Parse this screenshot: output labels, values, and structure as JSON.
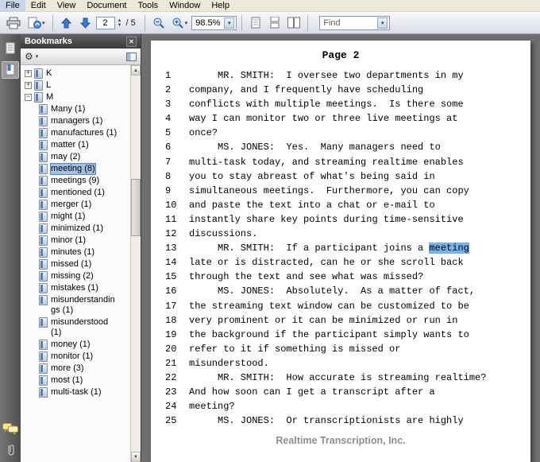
{
  "menu": {
    "items": [
      "File",
      "Edit",
      "View",
      "Document",
      "Tools",
      "Window",
      "Help"
    ]
  },
  "toolbar": {
    "page_value": "2",
    "page_total": "/ 5",
    "zoom_value": "98.5%",
    "find_value": "Find"
  },
  "icons": {
    "gear": "⚙",
    "close": "✕",
    "caret_down": "▾",
    "scroll_up": "▲",
    "scroll_down": "▼",
    "plus": "+",
    "minus": "−",
    "spinner_up": "▲",
    "spinner_down": "▼"
  },
  "colors": {
    "selection_blue": "#9cc2e8",
    "text_highlight": "#74b3ea",
    "doc_background": "#6e6e6e"
  },
  "panel": {
    "title": "Bookmarks",
    "items": [
      {
        "label": "K",
        "level": 0,
        "expander": "plus"
      },
      {
        "label": "L",
        "level": 0,
        "expander": "plus"
      },
      {
        "label": "M",
        "level": 0,
        "expander": "minus"
      },
      {
        "label": "Many (1)",
        "level": 1
      },
      {
        "label": "managers (1)",
        "level": 1
      },
      {
        "label": "manufactures (1)",
        "level": 1
      },
      {
        "label": "matter (1)",
        "level": 1
      },
      {
        "label": "may (2)",
        "level": 1
      },
      {
        "label": "meeting (8)",
        "level": 1,
        "selected": true
      },
      {
        "label": "meetings (9)",
        "level": 1
      },
      {
        "label": "mentioned (1)",
        "level": 1
      },
      {
        "label": "merger (1)",
        "level": 1
      },
      {
        "label": "might (1)",
        "level": 1
      },
      {
        "label": "minimized (1)",
        "level": 1
      },
      {
        "label": "minor (1)",
        "level": 1
      },
      {
        "label": "minutes (1)",
        "level": 1
      },
      {
        "label": "missed (1)",
        "level": 1
      },
      {
        "label": "missing (2)",
        "level": 1
      },
      {
        "label": "mistakes (1)",
        "level": 1
      },
      {
        "label": "misunderstandings (1)",
        "level": 1
      },
      {
        "label": "misunderstood (1)",
        "level": 1
      },
      {
        "label": "money (1)",
        "level": 1
      },
      {
        "label": "monitor (1)",
        "level": 1
      },
      {
        "label": "more (3)",
        "level": 1
      },
      {
        "label": "most (1)",
        "level": 1
      },
      {
        "label": "multi-task (1)",
        "level": 1
      }
    ]
  },
  "document": {
    "page_title": "Page 2",
    "footer": "Realtime Transcription, Inc.",
    "lines": [
      {
        "n": "1",
        "pre": "     MR. SMITH:  I oversee two departments in my"
      },
      {
        "n": "2",
        "pre": "company, and I frequently have scheduling"
      },
      {
        "n": "3",
        "pre": "conflicts with multiple meetings.  Is there some"
      },
      {
        "n": "4",
        "pre": "way I can monitor two or three live meetings at"
      },
      {
        "n": "5",
        "pre": "once?"
      },
      {
        "n": "6",
        "pre": "     MS. JONES:  Yes.  Many managers need to"
      },
      {
        "n": "7",
        "pre": "multi-task today, and streaming realtime enables"
      },
      {
        "n": "8",
        "pre": "you to stay abreast of what's being said in"
      },
      {
        "n": "9",
        "pre": "simultaneous meetings.  Furthermore, you can copy"
      },
      {
        "n": "10",
        "pre": "and paste the text into a chat or e-mail to"
      },
      {
        "n": "11",
        "pre": "instantly share key points during time-sensitive"
      },
      {
        "n": "12",
        "pre": "discussions."
      },
      {
        "n": "13",
        "pre": "     MR. SMITH:  If a participant joins a ",
        "hl": "meeting",
        "post": ""
      },
      {
        "n": "14",
        "pre": "late or is distracted, can he or she scroll back"
      },
      {
        "n": "15",
        "pre": "through the text and see what was missed?"
      },
      {
        "n": "16",
        "pre": "     MS. JONES:  Absolutely.  As a matter of fact,"
      },
      {
        "n": "17",
        "pre": "the streaming text window can be customized to be"
      },
      {
        "n": "18",
        "pre": "very prominent or it can be minimized or run in"
      },
      {
        "n": "19",
        "pre": "the background if the participant simply wants to"
      },
      {
        "n": "20",
        "pre": "refer to it if something is missed or"
      },
      {
        "n": "21",
        "pre": "misunderstood."
      },
      {
        "n": "22",
        "pre": "     MR. SMITH:  How accurate is streaming realtime?"
      },
      {
        "n": "23",
        "pre": "And how soon can I get a transcript after a"
      },
      {
        "n": "24",
        "pre": "meeting?"
      },
      {
        "n": "25",
        "pre": "     MS. JONES:  Or transcriptionists are highly"
      }
    ]
  }
}
